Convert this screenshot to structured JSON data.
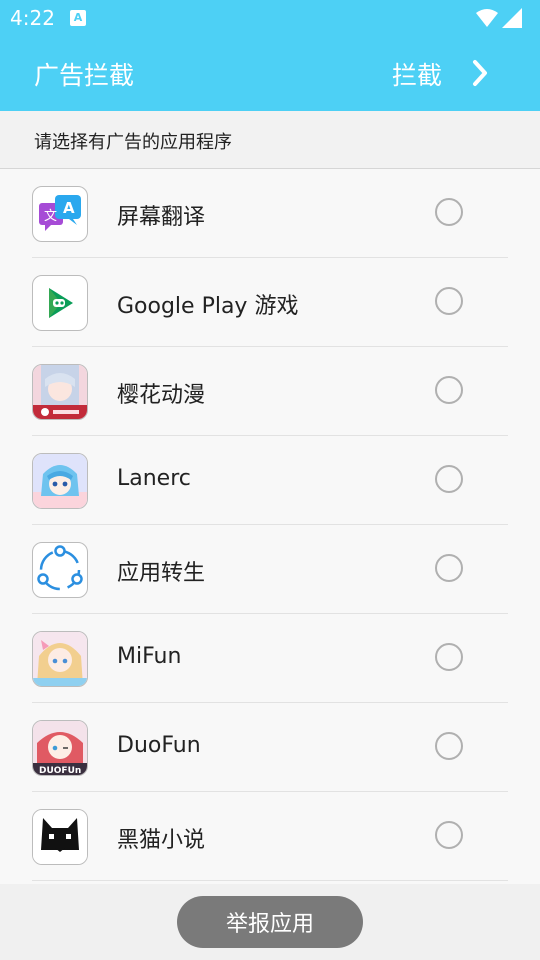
{
  "status_bar": {
    "time": "4:22",
    "notification_letter": "A"
  },
  "app_bar": {
    "title": "广告拦截",
    "action_label": "拦截"
  },
  "subheader": {
    "text": "请选择有广告的应用程序"
  },
  "apps": [
    {
      "name": "屏幕翻译",
      "icon": "translate-icon",
      "selected": false
    },
    {
      "name": "Google Play 游戏",
      "icon": "google-play-games-icon",
      "selected": false
    },
    {
      "name": "樱花动漫",
      "icon": "sakura-anime-icon",
      "selected": false
    },
    {
      "name": "Lanerc",
      "icon": "lanerc-icon",
      "selected": false
    },
    {
      "name": "应用转生",
      "icon": "app-rebirth-icon",
      "selected": false
    },
    {
      "name": "MiFun",
      "icon": "mifun-icon",
      "selected": false
    },
    {
      "name": "DuoFun",
      "icon": "duofun-icon",
      "selected": false
    },
    {
      "name": "黑猫小说",
      "icon": "black-cat-novel-icon",
      "selected": false
    }
  ],
  "icon_text": {
    "translate_zh": "文",
    "translate_en": "A",
    "duofun": "DUOFUn"
  },
  "bottom": {
    "report_button": "举报应用"
  },
  "colors": {
    "accent": "#4dd0f5",
    "button": "#7a7a7a"
  }
}
